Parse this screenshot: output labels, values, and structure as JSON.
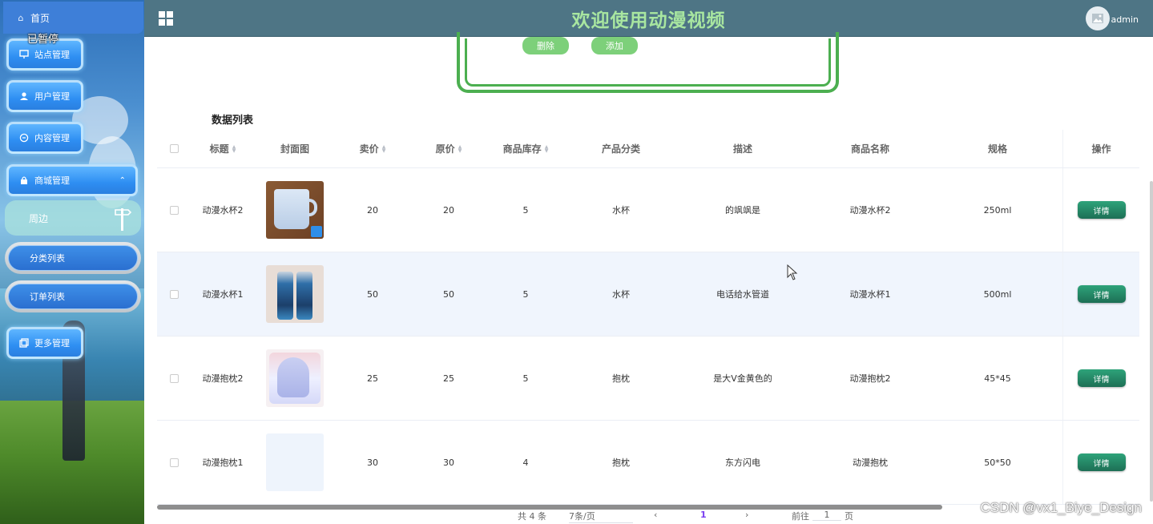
{
  "header": {
    "title": "欢迎使用动漫视频",
    "username": "admin"
  },
  "overlay": {
    "paused_label": "已暂停"
  },
  "sidebar": {
    "home_label": "首页",
    "items": [
      {
        "label": "站点管理",
        "icon": "monitor-icon"
      },
      {
        "label": "用户管理",
        "icon": "user-icon"
      },
      {
        "label": "内容管理",
        "icon": "chat-icon"
      },
      {
        "label": "商城管理",
        "icon": "lock-icon"
      },
      {
        "label": "更多管理",
        "icon": "copy-icon"
      }
    ],
    "sub_group_label": "周边",
    "sub_items": [
      {
        "label": "分类列表"
      },
      {
        "label": "订单列表"
      }
    ]
  },
  "actions": {
    "delete_label": "删除",
    "add_label": "添加"
  },
  "list": {
    "title": "数据列表",
    "columns": [
      "标题",
      "封面图",
      "卖价",
      "原价",
      "商品库存",
      "产品分类",
      "描述",
      "商品名称",
      "规格",
      "操作"
    ],
    "rows": [
      {
        "title": "动漫水杯2",
        "price": "20",
        "original": "20",
        "stock": "5",
        "category": "水杯",
        "desc": "的飒飒是",
        "name": "动漫水杯2",
        "spec": "250ml",
        "op": "详情"
      },
      {
        "title": "动漫水杯1",
        "price": "50",
        "original": "50",
        "stock": "5",
        "category": "水杯",
        "desc": "电话给水管道",
        "name": "动漫水杯1",
        "spec": "500ml",
        "op": "详情"
      },
      {
        "title": "动漫抱枕2",
        "price": "25",
        "original": "25",
        "stock": "5",
        "category": "抱枕",
        "desc": "是大V金黄色的",
        "name": "动漫抱枕2",
        "spec": "45*45",
        "op": "详情"
      },
      {
        "title": "动漫抱枕1",
        "price": "30",
        "original": "30",
        "stock": "4",
        "category": "抱枕",
        "desc": "东方闪电",
        "name": "动漫抱枕",
        "spec": "50*50",
        "op": "详情"
      }
    ]
  },
  "pagination": {
    "total": "共 4 条",
    "page_size": "7条/页",
    "current_page": "1",
    "goto_label": "前往",
    "goto_value": "1",
    "page_unit": "页",
    "prev": "‹",
    "next": "›"
  },
  "watermark": "CSDN @vx1_Biye_Design",
  "colors": {
    "header_bg": "#4e7585",
    "title_green": "#a8e6a0",
    "menu_blue": "#2e8ef2",
    "detail_btn": "#1d6f55",
    "frame_green": "#4caf50"
  }
}
